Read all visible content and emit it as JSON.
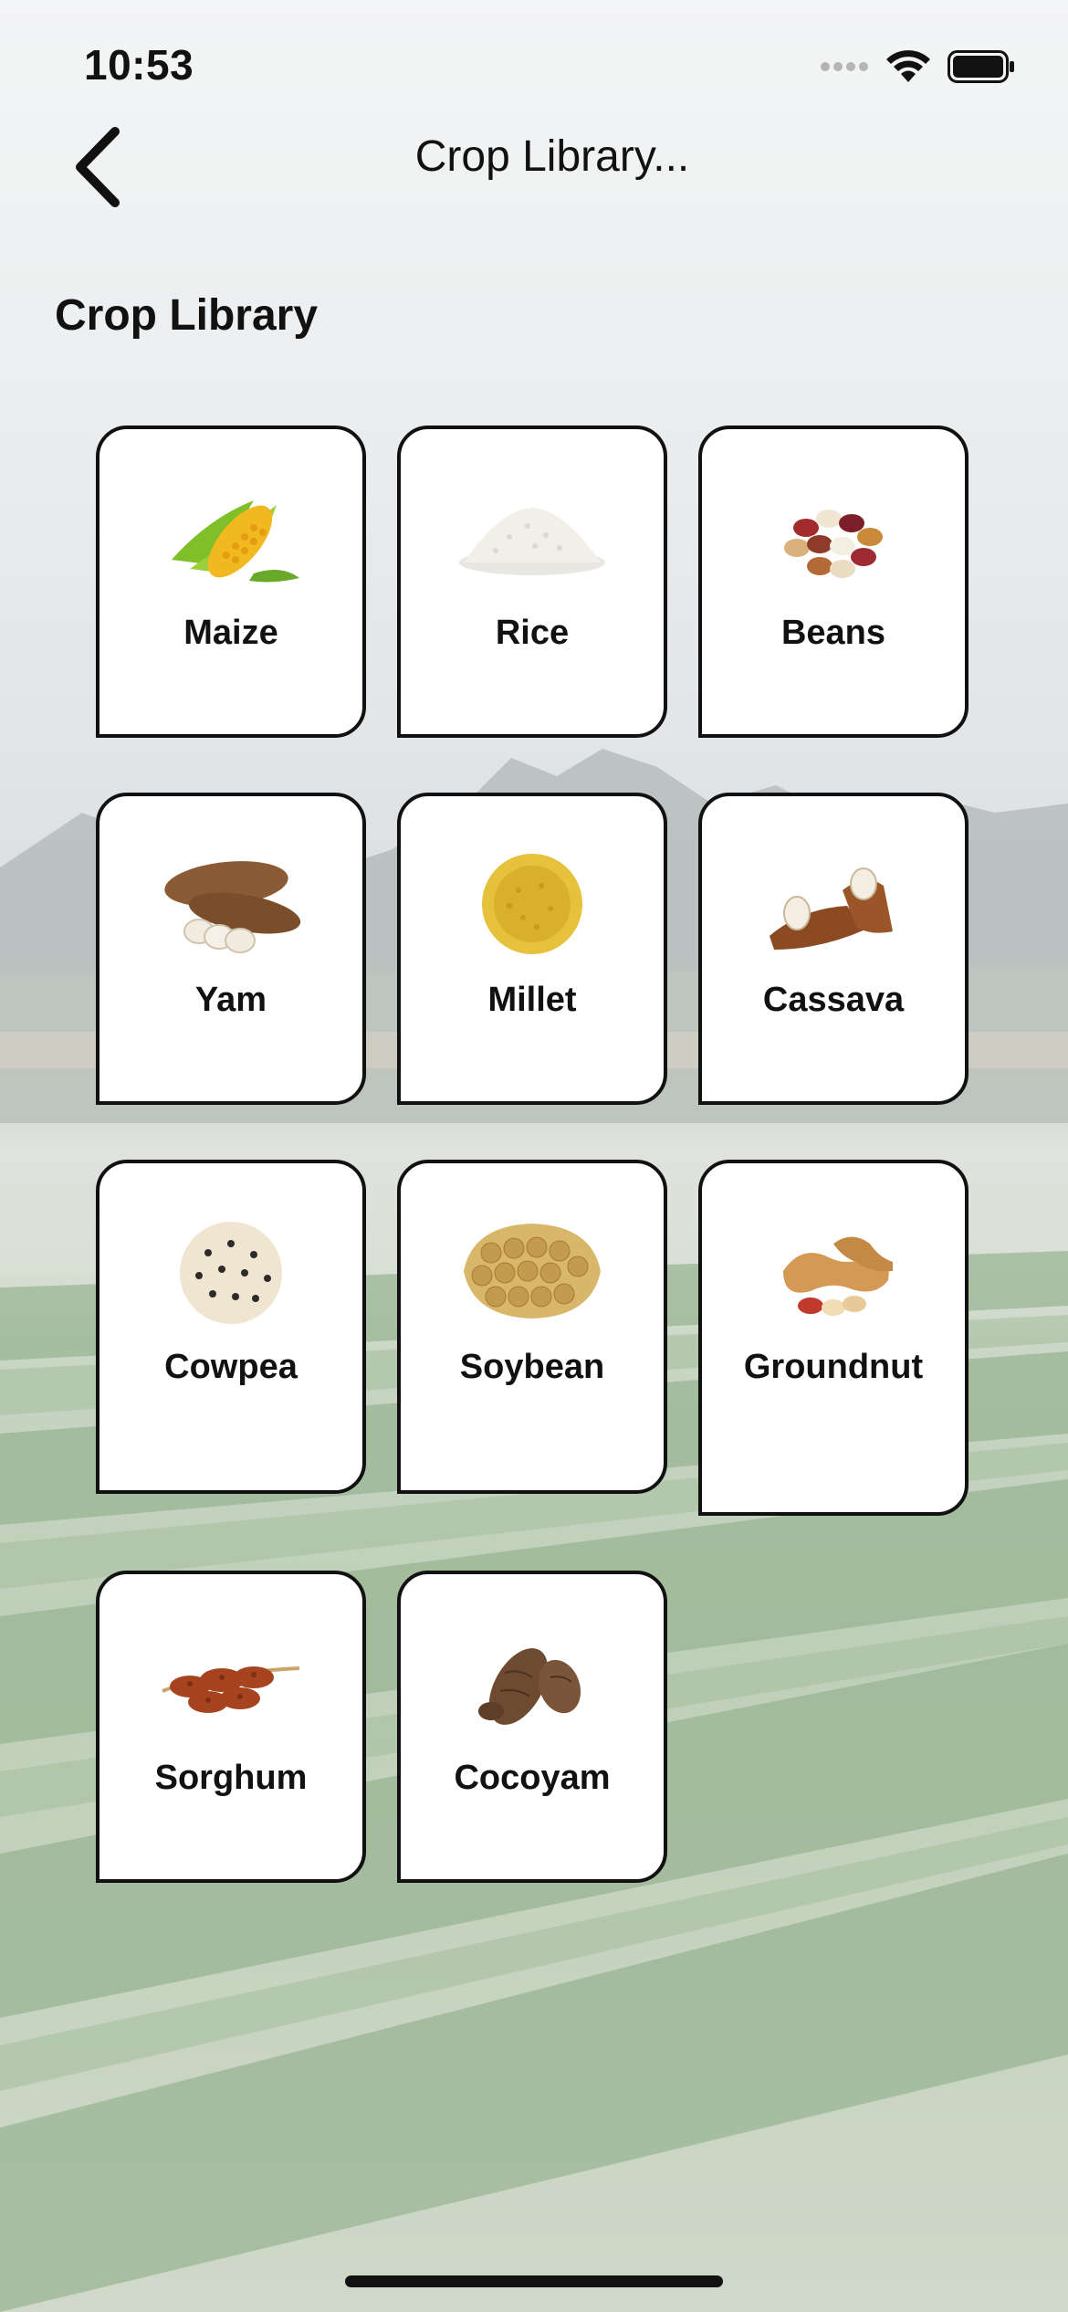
{
  "status_bar": {
    "time": "10:53",
    "signal_icon": "signal-dots-icon",
    "wifi_icon": "wifi-icon",
    "battery_icon": "battery-full-icon"
  },
  "nav": {
    "back_icon": "chevron-left-icon",
    "title": "Crop Library..."
  },
  "section_title": "Crop Library",
  "crops": [
    {
      "label": "Maize",
      "icon": "maize-image"
    },
    {
      "label": "Rice",
      "icon": "rice-image"
    },
    {
      "label": "Beans",
      "icon": "beans-image"
    },
    {
      "label": "Yam",
      "icon": "yam-image"
    },
    {
      "label": "Millet",
      "icon": "millet-image"
    },
    {
      "label": "Cassava",
      "icon": "cassava-image"
    },
    {
      "label": "Cowpea",
      "icon": "cowpea-image"
    },
    {
      "label": "Soybean",
      "icon": "soybean-image"
    },
    {
      "label": "Groundnut",
      "icon": "groundnut-image"
    },
    {
      "label": "Sorghum",
      "icon": "sorghum-image"
    },
    {
      "label": "Cocoyam",
      "icon": "cocoyam-image"
    }
  ]
}
